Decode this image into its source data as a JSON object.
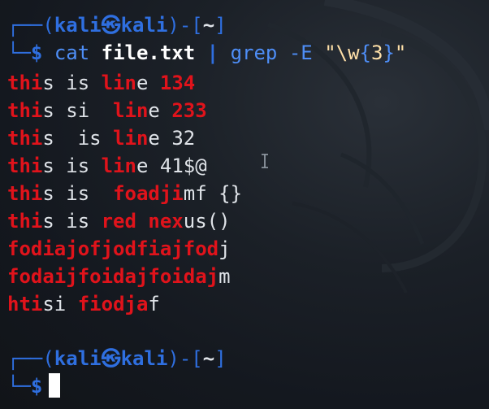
{
  "prompts": [
    {
      "open": "┌──(",
      "user": "kali",
      "at": "㉿",
      "host": "kali",
      "mid": ")-[",
      "path": "~",
      "close": "]",
      "lower": "└─",
      "dollar": "$"
    },
    {
      "open": "┌──(",
      "user": "kali",
      "at": "㉿",
      "host": "kali",
      "mid": ")-[",
      "path": "~",
      "close": "]",
      "lower": "└─",
      "dollar": "$"
    }
  ],
  "command": {
    "cmd": "cat",
    "arg": "file.txt",
    "pipe": "|",
    "cmd2": "grep",
    "flag": "-E",
    "q1": "\"\\w",
    "brace_open": "{",
    "num": "3",
    "brace_close": "}",
    "q2": "\""
  },
  "output": [
    [
      {
        "t": "thi",
        "h": true
      },
      {
        "t": "s is ",
        "h": false
      },
      {
        "t": "lin",
        "h": true
      },
      {
        "t": "e ",
        "h": false
      },
      {
        "t": "134",
        "h": true
      }
    ],
    [
      {
        "t": "thi",
        "h": true
      },
      {
        "t": "s si  ",
        "h": false
      },
      {
        "t": "lin",
        "h": true
      },
      {
        "t": "e ",
        "h": false
      },
      {
        "t": "233",
        "h": true
      }
    ],
    [
      {
        "t": "thi",
        "h": true
      },
      {
        "t": "s  is ",
        "h": false
      },
      {
        "t": "lin",
        "h": true
      },
      {
        "t": "e 32",
        "h": false
      }
    ],
    [
      {
        "t": "thi",
        "h": true
      },
      {
        "t": "s is ",
        "h": false
      },
      {
        "t": "lin",
        "h": true
      },
      {
        "t": "e 41$@",
        "h": false
      }
    ],
    [
      {
        "t": "thi",
        "h": true
      },
      {
        "t": "s is  ",
        "h": false
      },
      {
        "t": "foadji",
        "h": true
      },
      {
        "t": "mf {}",
        "h": false
      }
    ],
    [
      {
        "t": "thi",
        "h": true
      },
      {
        "t": "s is ",
        "h": false
      },
      {
        "t": "red nex",
        "h": true
      },
      {
        "t": "us()",
        "h": false
      }
    ],
    [
      {
        "t": "fodiajofjodfiajfod",
        "h": true
      },
      {
        "t": "j",
        "h": false
      }
    ],
    [
      {
        "t": "fodaijfoidajfoidaj",
        "h": true
      },
      {
        "t": "m",
        "h": false
      }
    ],
    [
      {
        "t": "hti",
        "h": true
      },
      {
        "t": "si ",
        "h": false
      },
      {
        "t": "fiodja",
        "h": true
      },
      {
        "t": "f",
        "h": false
      }
    ]
  ],
  "icons": {
    "text_cursor": "i-beam-icon",
    "block_cursor": "block-cursor"
  },
  "colors": {
    "prompt_blue": "#2f6fe0",
    "match_red": "#e0131b",
    "background": "#14181f",
    "text": "#dfe3e8"
  }
}
